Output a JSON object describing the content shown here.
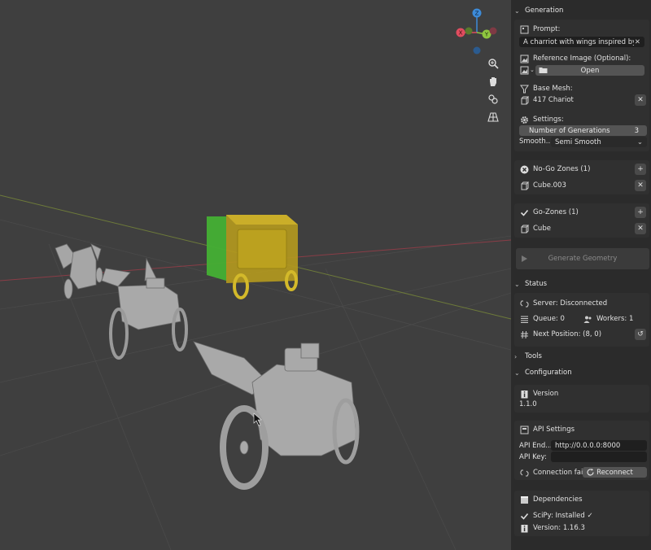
{
  "viewport": {
    "navigation_tools": [
      "zoom-icon",
      "hand-pan-icon",
      "camera-icon",
      "perspective-grid-icon"
    ],
    "axes": {
      "x": "X",
      "y": "Y",
      "z": "Z"
    },
    "colors": {
      "x_axis": "#e04d5f",
      "y_axis": "#8ec63f",
      "z_axis": "#3d8bd8",
      "go_zone": "#4cbb3a",
      "nogo_zone": "#c9a61a",
      "mesh": "#a9a9a9"
    }
  },
  "generation": {
    "title": "Generation",
    "prompt_label": "Prompt:",
    "prompt_value": "A charriot with wings inspired by r...",
    "ref_label": "Reference Image (Optional):",
    "open_button": "Open",
    "base_mesh_label": "Base Mesh:",
    "base_mesh_value": "417 Chariot",
    "settings_label": "Settings:",
    "num_gen_label": "Number of Generations",
    "num_gen_value": "3",
    "smooth_label": "Smooth...",
    "smooth_value": "Semi Smooth"
  },
  "nogo": {
    "title": "No-Go Zones (1)",
    "item": "Cube.003"
  },
  "go": {
    "title": "Go-Zones (1)",
    "item": "Cube"
  },
  "generate_button": "Generate Geometry",
  "status": {
    "title": "Status",
    "server": "Server: Disconnected",
    "queue": "Queue: 0",
    "workers": "Workers: 1",
    "next_position": "Next Position: (8, 0)"
  },
  "tools": {
    "title": "Tools"
  },
  "configuration": {
    "title": "Configuration",
    "version_label": "Version",
    "version_value": "1.1.0",
    "api_settings_label": "API Settings",
    "api_endpoint_label": "API End...",
    "api_endpoint_value": "http://0.0.0.0:8000",
    "api_key_label": "API Key:",
    "api_key_value": "",
    "connection_status": "Connection fai...",
    "reconnect_button": "Reconnect",
    "dependencies_label": "Dependencies",
    "scipy_status": "SciPy: Installed ✓",
    "scipy_version": "Version: 1.16.3"
  }
}
